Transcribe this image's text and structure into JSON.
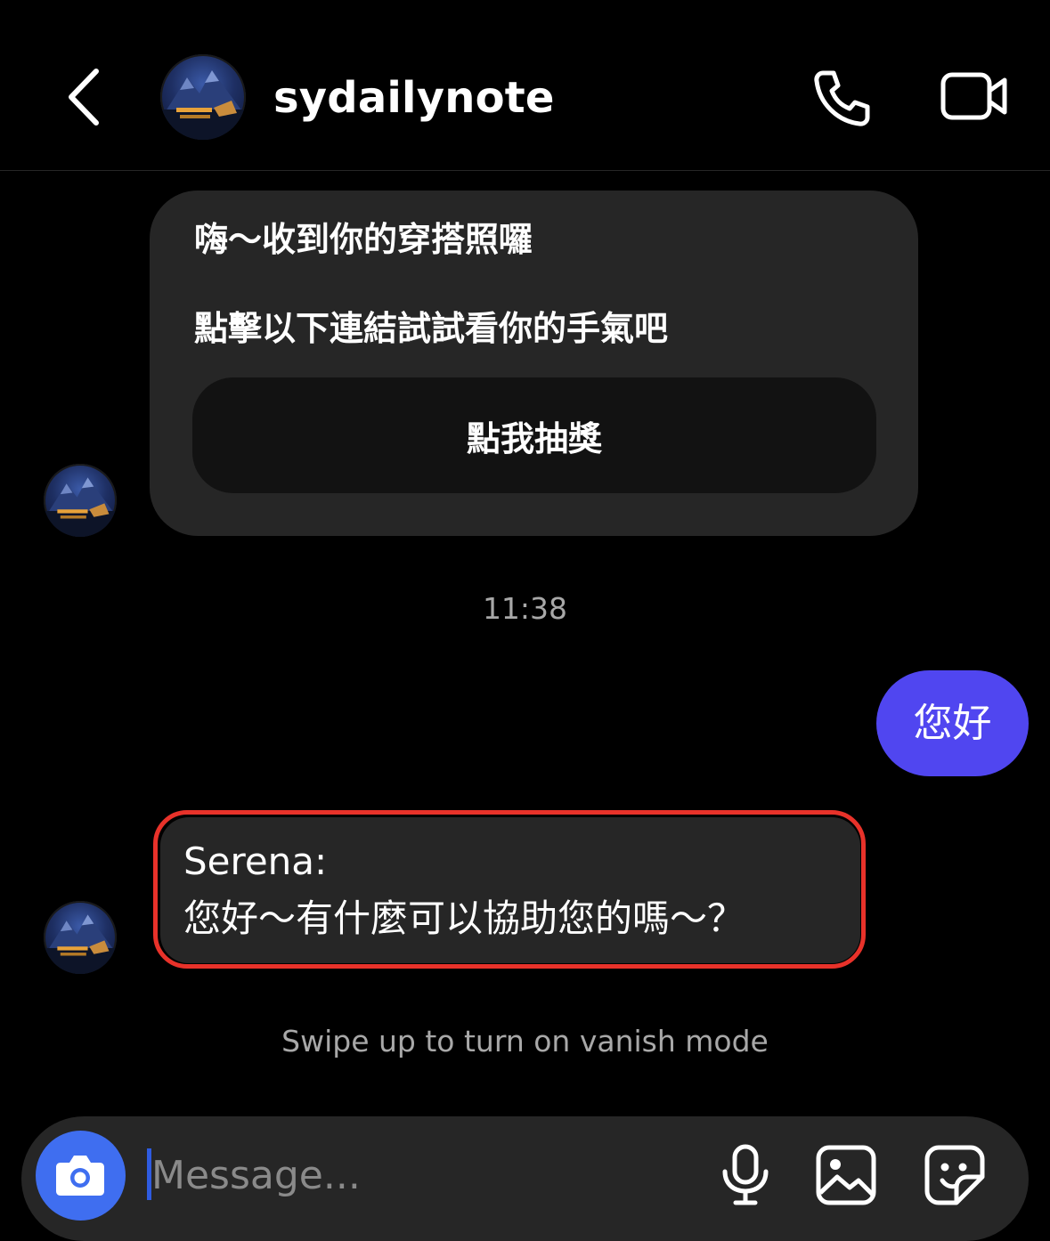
{
  "header": {
    "username": "sydailynote",
    "back_icon": "chevron-left-icon",
    "call_icon": "phone-icon",
    "video_icon": "video-camera-icon"
  },
  "messages": {
    "card": {
      "line1": "嗨～收到你的穿搭照囉",
      "line2": "點擊以下連結試試看你的手氣吧",
      "button_label": "點我抽獎"
    },
    "timestamp": "11:38",
    "sent": {
      "text": "您好"
    },
    "received": {
      "line1": "Serena:",
      "line2": "您好～有什麼可以協助您的嗎～？"
    }
  },
  "vanish_hint": "Swipe up to turn on vanish mode",
  "composer": {
    "placeholder": "Message...",
    "camera_icon": "camera-icon",
    "mic_icon": "microphone-icon",
    "gallery_icon": "image-icon",
    "sticker_icon": "sticker-icon"
  },
  "colors": {
    "background": "#000000",
    "bubble_received": "#262626",
    "bubble_sent": "#5046f0",
    "camera_button": "#3f6ef0",
    "highlight_border": "#e8322a",
    "muted_text": "#a8a8a8"
  }
}
